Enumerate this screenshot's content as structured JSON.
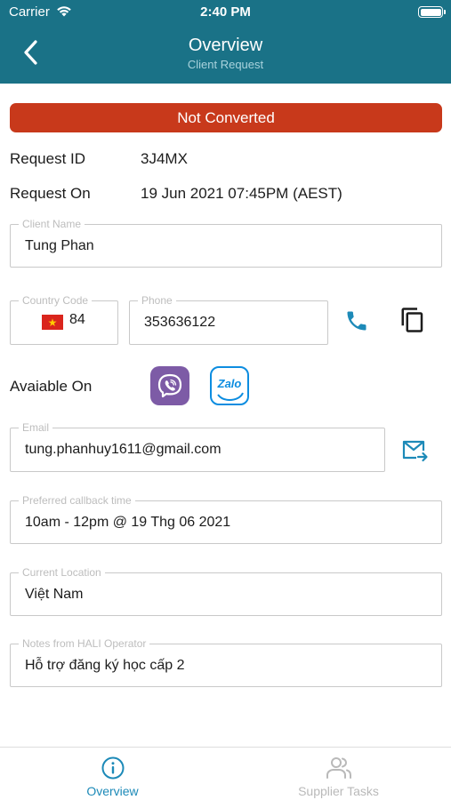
{
  "status_bar": {
    "carrier": "Carrier",
    "time": "2:40 PM"
  },
  "header": {
    "title": "Overview",
    "subtitle": "Client Request"
  },
  "status_banner": {
    "label": "Not Converted",
    "color": "#c8391b"
  },
  "info": {
    "request_id_label": "Request ID",
    "request_id_value": "3J4MX",
    "request_on_label": "Request On",
    "request_on_value": "19 Jun 2021 07:45PM (AEST)"
  },
  "client_name": {
    "label": "Client Name",
    "value": "Tung Phan"
  },
  "country_code": {
    "label": "Country Code",
    "value": "84",
    "flag": "vietnam-flag"
  },
  "phone": {
    "label": "Phone",
    "value": "353636122"
  },
  "available_on": {
    "label": "Avaiable On",
    "apps": [
      "viber",
      "Zalo"
    ]
  },
  "email": {
    "label": "Email",
    "value": "tung.phanhuy1611@gmail.com"
  },
  "callback_time": {
    "label": "Preferred callback time",
    "value": "10am - 12pm @ 19 Thg 06 2021"
  },
  "current_location": {
    "label": "Current Location",
    "value": "Việt Nam"
  },
  "notes": {
    "label": "Notes from HALI Operator",
    "value": "Hỗ trợ đăng ký học cấp 2"
  },
  "tabs": [
    {
      "label": "Overview",
      "icon": "info-icon",
      "active": true
    },
    {
      "label": "Supplier Tasks",
      "icon": "users-icon",
      "active": false
    }
  ],
  "colors": {
    "header": "#1a7287",
    "accent": "#1d8ab8",
    "banner": "#c8391b",
    "tab_inactive": "#b9b9b9"
  }
}
